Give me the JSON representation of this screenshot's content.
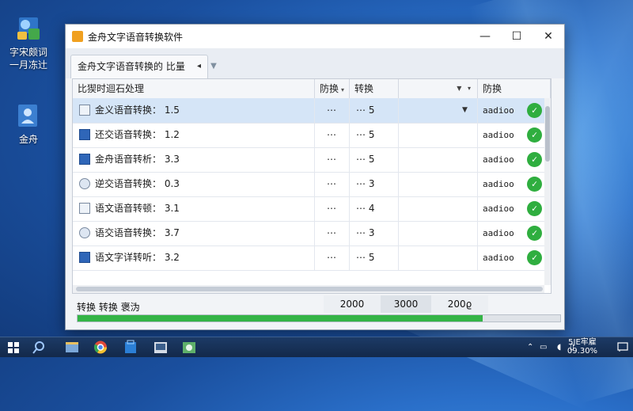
{
  "desktop": {
    "icons": [
      {
        "line1": "字宋颇词",
        "line2": "一月冻辻"
      },
      {
        "line1": "金舟",
        "line2": ""
      }
    ]
  },
  "window": {
    "title": "金舟文字语音转换软件",
    "controls": {
      "minimize": "—",
      "maximize": "☐",
      "close": "✕"
    },
    "tab": {
      "label": "金舟文字语音转换的 比量",
      "marker": "◂"
    }
  },
  "grid": {
    "columns": [
      "比猰时迴石处理",
      "防换",
      "转换",
      "",
      "防换"
    ],
    "rows": [
      {
        "name": "金义语音转换",
        "value": "1.5",
        "c1": "⋯",
        "c2": "⋯ 5",
        "c4": "aadioo",
        "ok": true,
        "selected": true
      },
      {
        "name": "还交语音转换",
        "value": "1.2",
        "c1": "⋯",
        "c2": "⋯ 5",
        "c4": "aadioo",
        "ok": true,
        "selected": false
      },
      {
        "name": "金舟语音转析",
        "value": "3.3",
        "c1": "⋯",
        "c2": "⋯ 5",
        "c4": "aadioo",
        "ok": true,
        "selected": false
      },
      {
        "name": "逆交语音转换",
        "value": "0.3",
        "c1": "⋯",
        "c2": "⋯ 3",
        "c4": "aadioo",
        "ok": true,
        "selected": false
      },
      {
        "name": "语文语音转顿",
        "value": "3.1",
        "c1": "⋯",
        "c2": "⋯ 4",
        "c4": "aadioo",
        "ok": true,
        "selected": false
      },
      {
        "name": "语交语音转换",
        "value": "3.7",
        "c1": "⋯",
        "c2": "⋯ 3",
        "c4": "aadioo",
        "ok": true,
        "selected": false
      },
      {
        "name": "语文字详转听",
        "value": "3.2",
        "c1": "⋯",
        "c2": "⋯ 5",
        "c4": "aadioo",
        "ok": true,
        "selected": false
      }
    ]
  },
  "status": {
    "text": "转换 转换 褒沩",
    "seg1": "2000",
    "seg2": "3000",
    "seg3": "200ϱ",
    "progress": 0.84
  },
  "taskbar": {
    "clock_line1": "5JE牢雇",
    "clock_line2": "09.30%",
    "colors": {
      "start": "#2b7fd6",
      "chrome": "#e04a3a"
    }
  },
  "icons": {
    "app": "app-logo-icon",
    "check": "check-circle-icon",
    "windows": "windows-start-icon"
  }
}
